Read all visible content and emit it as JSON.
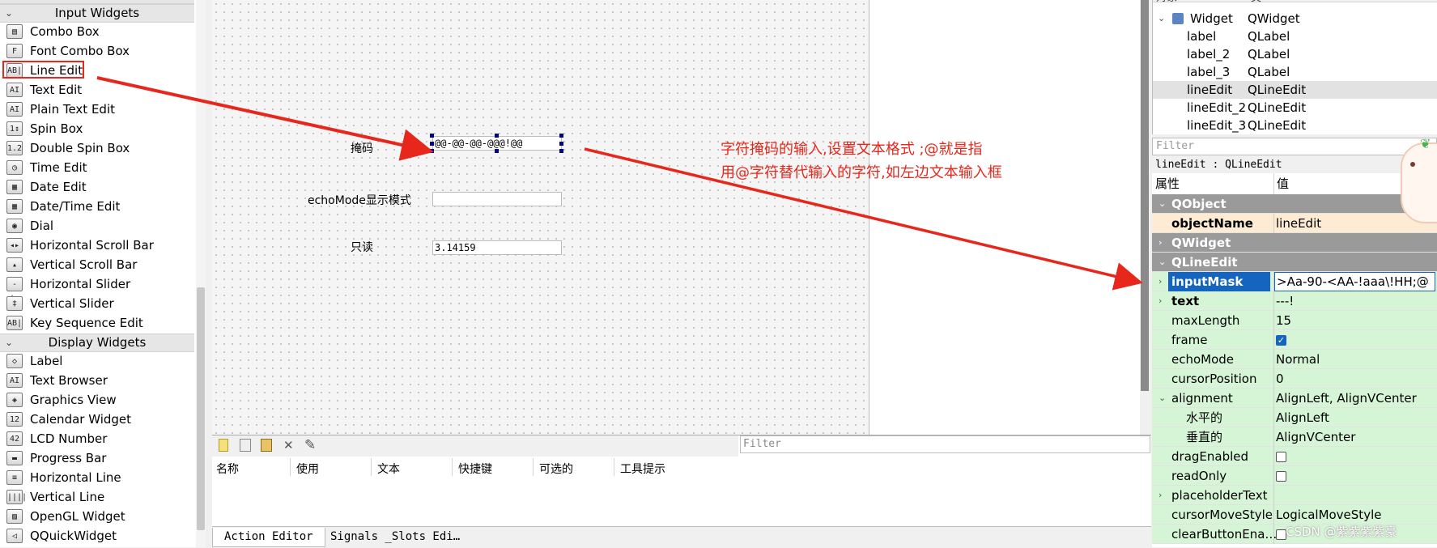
{
  "widget_box": {
    "categories": [
      {
        "label": "Input Widgets"
      },
      {
        "label": "Display Widgets"
      }
    ],
    "input_widgets": [
      {
        "label": "Combo Box",
        "icon": "combo-box-icon",
        "glyph": "▤"
      },
      {
        "label": "Font Combo Box",
        "icon": "font-combo-box-icon",
        "glyph": "F"
      },
      {
        "label": "Line Edit",
        "icon": "line-edit-icon",
        "glyph": "AB|"
      },
      {
        "label": "Text Edit",
        "icon": "text-edit-icon",
        "glyph": "AI"
      },
      {
        "label": "Plain Text Edit",
        "icon": "plain-text-edit-icon",
        "glyph": "AI"
      },
      {
        "label": "Spin Box",
        "icon": "spin-box-icon",
        "glyph": "1↕"
      },
      {
        "label": "Double Spin Box",
        "icon": "double-spin-box-icon",
        "glyph": "1.2"
      },
      {
        "label": "Time Edit",
        "icon": "time-edit-icon",
        "glyph": "◷"
      },
      {
        "label": "Date Edit",
        "icon": "date-edit-icon",
        "glyph": "▦"
      },
      {
        "label": "Date/Time Edit",
        "icon": "date-time-edit-icon",
        "glyph": "▦"
      },
      {
        "label": "Dial",
        "icon": "dial-icon",
        "glyph": "◉"
      },
      {
        "label": "Horizontal Scroll Bar",
        "icon": "horizontal-scroll-bar-icon",
        "glyph": "◂▸"
      },
      {
        "label": "Vertical Scroll Bar",
        "icon": "vertical-scroll-bar-icon",
        "glyph": "▴"
      },
      {
        "label": "Horizontal Slider",
        "icon": "horizontal-slider-icon",
        "glyph": "-|-"
      },
      {
        "label": "Vertical Slider",
        "icon": "vertical-slider-icon",
        "glyph": "‡"
      },
      {
        "label": "Key Sequence Edit",
        "icon": "key-sequence-edit-icon",
        "glyph": "AB|"
      }
    ],
    "display_widgets": [
      {
        "label": "Label",
        "icon": "label-icon",
        "glyph": "◇"
      },
      {
        "label": "Text Browser",
        "icon": "text-browser-icon",
        "glyph": "AI"
      },
      {
        "label": "Graphics View",
        "icon": "graphics-view-icon",
        "glyph": "◈"
      },
      {
        "label": "Calendar Widget",
        "icon": "calendar-widget-icon",
        "glyph": "12"
      },
      {
        "label": "LCD Number",
        "icon": "lcd-number-icon",
        "glyph": "42"
      },
      {
        "label": "Progress Bar",
        "icon": "progress-bar-icon",
        "glyph": "▬"
      },
      {
        "label": "Horizontal Line",
        "icon": "horizontal-line-icon",
        "glyph": "≡"
      },
      {
        "label": "Vertical Line",
        "icon": "vertical-line-icon",
        "glyph": "||||"
      },
      {
        "label": "OpenGL Widget",
        "icon": "opengl-widget-icon",
        "glyph": "▨"
      },
      {
        "label": "QQuickWidget",
        "icon": "qquickwidget-icon",
        "glyph": "◁"
      }
    ]
  },
  "form": {
    "mask_label": "掩码",
    "mask_value": "@@-@@-@@-@@@!@@",
    "echo_label": "echoMode显示模式",
    "echo_value": "",
    "readonly_label": "只读",
    "readonly_value": "3.14159"
  },
  "annotation": {
    "line1": "字符掩码的输入,设置文本格式   ;@就是指",
    "line2": "用@字符替代输入的字符,如左边文本输入框",
    "color": "#e8271c"
  },
  "action_editor": {
    "filter_placeholder": "Filter",
    "columns": [
      "名称",
      "使用",
      "文本",
      "快捷键",
      "可选的",
      "工具提示"
    ],
    "tabs": [
      "Action Editor",
      "Signals _Slots Edi…"
    ]
  },
  "object_inspector": {
    "header_object": "对象",
    "header_class": "类",
    "root": {
      "name": "Widget",
      "class": "QWidget"
    },
    "children": [
      {
        "name": "label",
        "class": "QLabel"
      },
      {
        "name": "label_2",
        "class": "QLabel"
      },
      {
        "name": "label_3",
        "class": "QLabel"
      },
      {
        "name": "lineEdit",
        "class": "QLineEdit"
      },
      {
        "name": "lineEdit_2",
        "class": "QLineEdit"
      },
      {
        "name": "lineEdit_3",
        "class": "QLineEdit"
      }
    ]
  },
  "property_editor": {
    "filter_placeholder": "Filter",
    "title": "lineEdit : QLineEdit",
    "col_property": "属性",
    "col_value": "值",
    "rows": [
      {
        "kind": "cat",
        "name": "QObject"
      },
      {
        "kind": "prop",
        "name": "objectName",
        "value": "lineEdit",
        "bold": true
      },
      {
        "kind": "cat",
        "name": "QWidget"
      },
      {
        "kind": "cat",
        "name": "QLineEdit"
      },
      {
        "kind": "prop",
        "name": "inputMask",
        "value": ">Aa-90-<AA-!aaa\\!HH;@",
        "bold": true,
        "selected": true,
        "expandable": true
      },
      {
        "kind": "prop",
        "name": "text",
        "value": "---!",
        "bold": true,
        "expandable": true
      },
      {
        "kind": "prop",
        "name": "maxLength",
        "value": "15"
      },
      {
        "kind": "prop",
        "name": "frame",
        "value": "",
        "check": true
      },
      {
        "kind": "prop",
        "name": "echoMode",
        "value": "Normal"
      },
      {
        "kind": "prop",
        "name": "cursorPosition",
        "value": "0"
      },
      {
        "kind": "prop",
        "name": "alignment",
        "value": "AlignLeft, AlignVCenter",
        "expanded": true
      },
      {
        "kind": "sub",
        "name": "水平的",
        "value": "AlignLeft"
      },
      {
        "kind": "sub",
        "name": "垂直的",
        "value": "AlignVCenter"
      },
      {
        "kind": "prop",
        "name": "dragEnabled",
        "value": "",
        "check": false
      },
      {
        "kind": "prop",
        "name": "readOnly",
        "value": "",
        "check": false
      },
      {
        "kind": "prop",
        "name": "placeholderText",
        "value": "",
        "expandable": true
      },
      {
        "kind": "prop",
        "name": "cursorMoveStyle",
        "value": "LogicalMoveStyle"
      },
      {
        "kind": "prop",
        "name": "clearButtonEna…",
        "value": "",
        "check": false
      }
    ]
  },
  "watermark": "CSDN @紫紫紫紫豪"
}
